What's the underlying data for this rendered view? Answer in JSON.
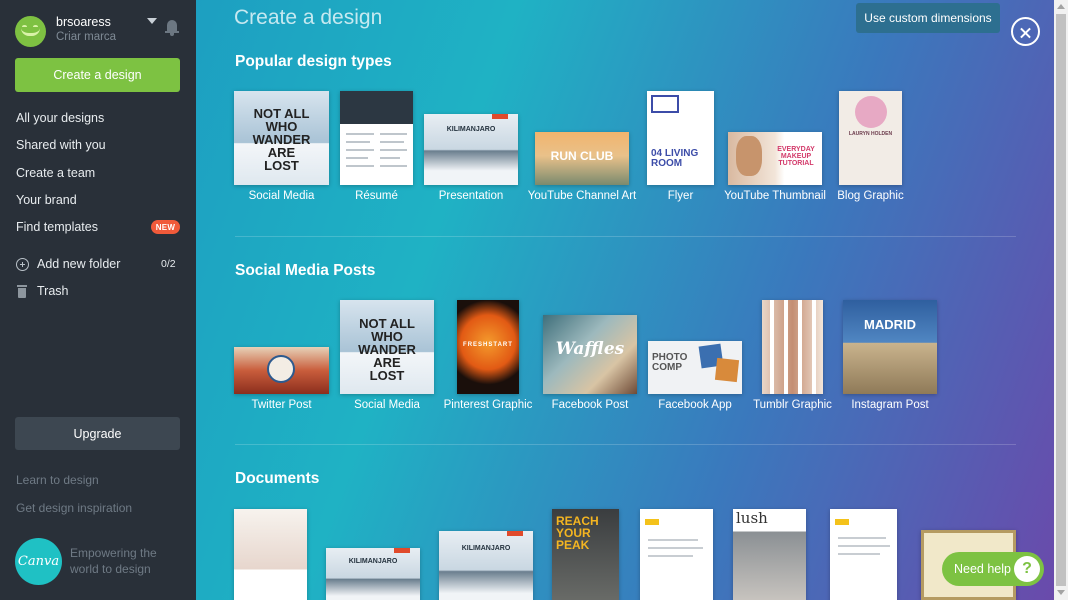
{
  "user": {
    "name": "brsoaress",
    "brand_sub": "Criar marca"
  },
  "sidebar": {
    "create_label": "Create a design",
    "nav": [
      {
        "label": "All your designs"
      },
      {
        "label": "Shared with you"
      },
      {
        "label": "Create a team"
      },
      {
        "label": "Your brand"
      },
      {
        "label": "Find templates",
        "badge": "NEW"
      }
    ],
    "add_folder": {
      "label": "Add new folder",
      "count": "0/2"
    },
    "trash": "Trash",
    "upgrade": "Upgrade",
    "links": [
      "Learn to design",
      "Get design inspiration"
    ],
    "logo_text": "Canva",
    "tagline": "Empowering the world to design"
  },
  "main": {
    "title": "Create a design",
    "custom_dimensions": "Use custom dimensions",
    "sections": [
      {
        "title": "Popular design types",
        "items": [
          "Social Media",
          "Résumé",
          "Presentation",
          "YouTube Channel Art",
          "Flyer",
          "YouTube Thumbnail",
          "Blog Graphic"
        ]
      },
      {
        "title": "Social Media Posts",
        "items": [
          "Twitter Post",
          "Social Media",
          "Pinterest Graphic",
          "Facebook Post",
          "Facebook App",
          "Tumblr Graphic",
          "Instagram Post"
        ]
      },
      {
        "title": "Documents"
      }
    ],
    "thumb_text": {
      "lost": "NOT ALL WHO WANDER ARE LOST",
      "kilimanjaro": "KILIMANJARO",
      "run_club": "RUN CLUB",
      "flyer_living": "04 LIVING ROOM",
      "makeup": "EVERYDAY MAKEUP TUTORIAL",
      "blog_name": "LAURYN HOLDEN",
      "freshstart": "FRESHSTART",
      "waffles": "Waffles",
      "photo_comp": "PHOTO COMP",
      "madrid": "MADRID",
      "reach": "REACH YOUR PEAK",
      "lush": "lush"
    }
  },
  "help": {
    "label": "Need help",
    "icon": "?"
  },
  "colors": {
    "accent": "#7dc242",
    "sidebar": "#293039",
    "badge": "#f05a3a"
  }
}
